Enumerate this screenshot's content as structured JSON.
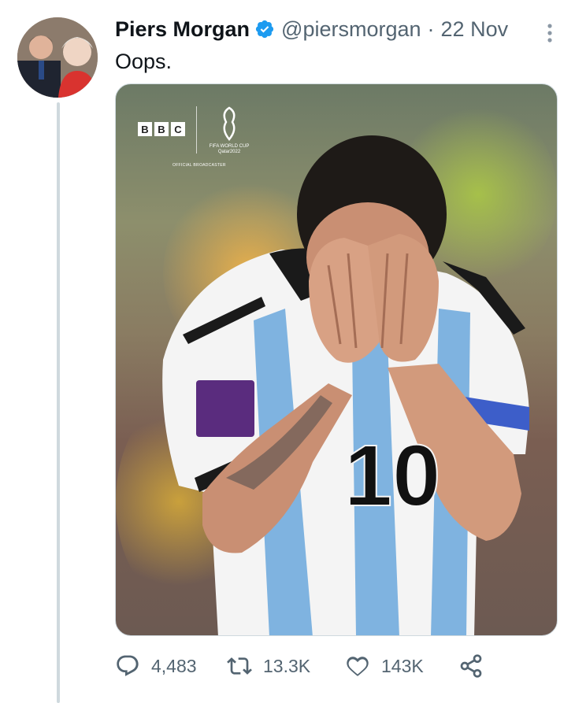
{
  "tweet": {
    "author_name": "Piers Morgan",
    "handle": "@piersmorgan",
    "separator": "·",
    "date": "22 Nov",
    "text": "Oops.",
    "verified": true
  },
  "media": {
    "logo_bbc": [
      "B",
      "B",
      "C"
    ],
    "logo_wc": "FIFA WORLD CUP Qatar2022",
    "logo_official": "OFFICIAL BROADCASTER",
    "patch_text": "FIFA WORLD CUP Qatar2022",
    "shirt_number": "10"
  },
  "actions": {
    "replies": "4,483",
    "retweets": "13.3K",
    "likes": "143K"
  },
  "icons": {
    "verified": "verified-badge-icon",
    "more": "more-vertical-icon",
    "reply": "reply-icon",
    "retweet": "retweet-icon",
    "like": "heart-icon",
    "share": "share-icon"
  },
  "colors": {
    "verified_blue": "#1d9bf0",
    "secondary_text": "#536471",
    "thread_line": "#cfd9de"
  }
}
